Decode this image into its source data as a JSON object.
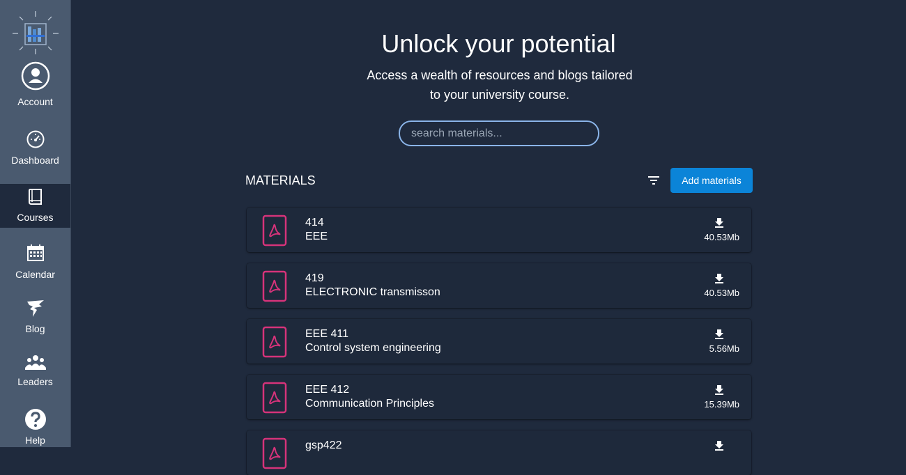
{
  "sidebar": {
    "items": [
      {
        "label": "Account",
        "icon": "account-icon"
      },
      {
        "label": "Dashboard",
        "icon": "speedometer-icon"
      },
      {
        "label": "Courses",
        "icon": "book-icon",
        "active": true
      },
      {
        "label": "Calendar",
        "icon": "calendar-icon"
      },
      {
        "label": "Blog",
        "icon": "blog-icon"
      },
      {
        "label": "Leaders",
        "icon": "group-icon"
      },
      {
        "label": "Help",
        "icon": "help-icon"
      }
    ]
  },
  "hero": {
    "title": "Unlock your potential",
    "subtitle": "Access a wealth of resources and blogs tailored to your university course."
  },
  "search": {
    "placeholder": "search materials..."
  },
  "materials": {
    "title": "MATERIALS",
    "add_label": "Add materials",
    "items": [
      {
        "code": "414",
        "name": "EEE",
        "size": "40.53Mb"
      },
      {
        "code": "419",
        "name": "ELECTRONIC transmisson",
        "size": "40.53Mb"
      },
      {
        "code": "EEE 411",
        "name": "Control system engineering",
        "size": "5.56Mb"
      },
      {
        "code": "EEE 412",
        "name": "Communication Principles",
        "size": "15.39Mb"
      },
      {
        "code": "gsp422",
        "name": "",
        "size": ""
      }
    ]
  },
  "colors": {
    "background": "#1f2a3d",
    "sidebar": "#4a5a6f",
    "accent": "#0b84d8",
    "pdf": "#d6337a",
    "search_border": "#8ab4e8"
  }
}
